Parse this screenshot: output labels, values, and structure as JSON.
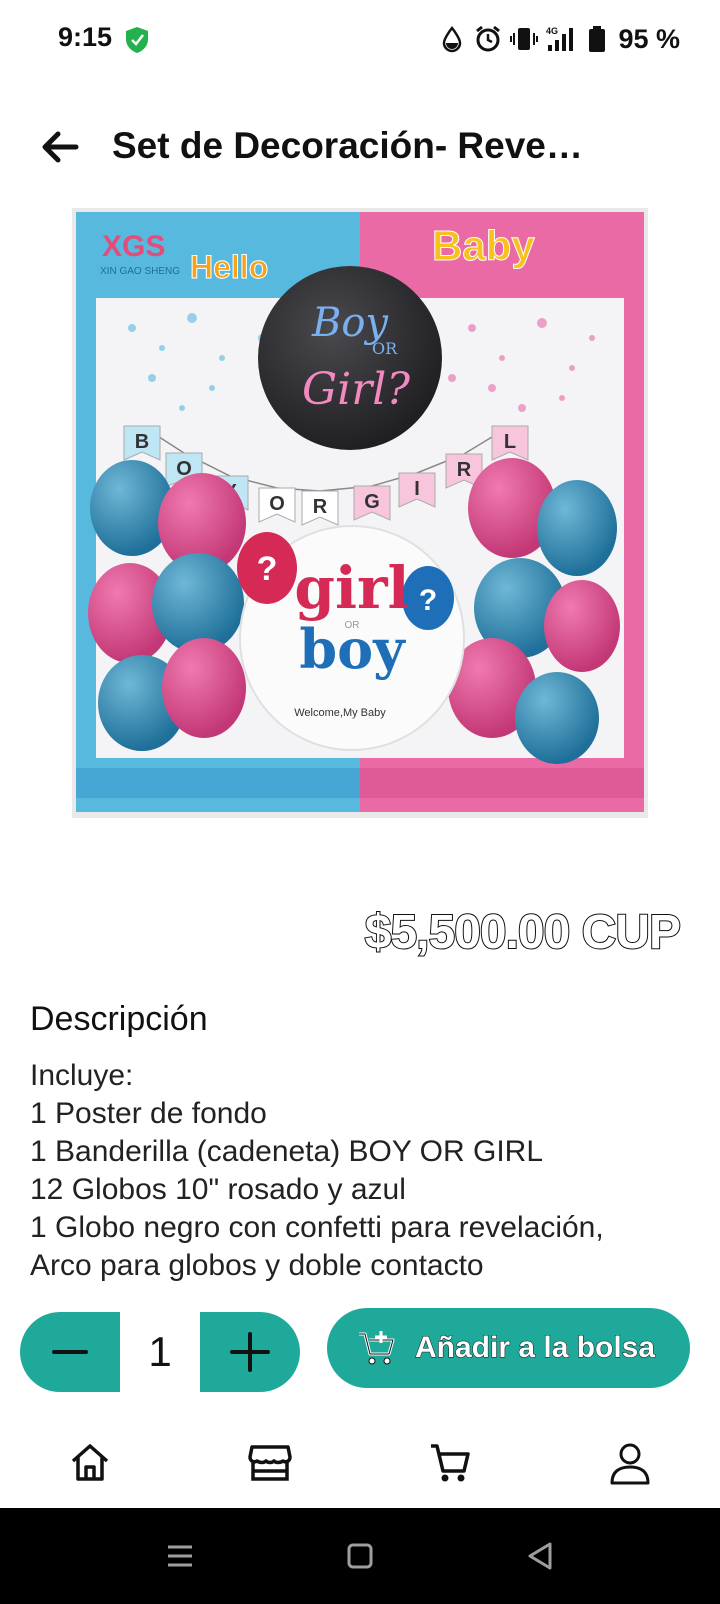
{
  "status_bar": {
    "time": "9:15",
    "battery_text": "95 %",
    "network_label": "4G",
    "icons": [
      "shield-check-icon",
      "water-drop-icon",
      "alarm-icon",
      "vibrate-icon",
      "signal-icon",
      "battery-icon"
    ]
  },
  "header": {
    "title": "Set de Decoración- Reve…",
    "back_icon": "arrow-left-icon"
  },
  "product_image": {
    "brand": "XGS",
    "brand_sub": "XIN GAO SHENG",
    "hello": "Hello",
    "baby": "Baby",
    "balloon_top_1": "Boy",
    "balloon_top_or": "OR",
    "balloon_top_2": "Girl?",
    "banner_letters": [
      "B",
      "O",
      "Y",
      "O",
      "R",
      "G",
      "I",
      "R",
      "L"
    ],
    "sign_line_1": "girl",
    "sign_line_or": "OR",
    "sign_line_2": "boy",
    "sign_welcome": "Welcome,My Baby",
    "colors": {
      "blue": "#4fb3d8",
      "pink": "#e0609a",
      "dark_balloon": "#2a2a2e"
    }
  },
  "product": {
    "price": "$5,500.00 CUP",
    "description_title": "Descripción",
    "description_lines": [
      "Incluye:",
      "1 Poster de fondo",
      "1 Banderilla (cadeneta) BOY OR GIRL",
      "12 Globos 10\" rosado y azul",
      "1 Globo negro con confetti para revelación,",
      "Arco para globos y doble contacto"
    ]
  },
  "cart_controls": {
    "quantity": "1",
    "add_label": "Añadir a la bolsa",
    "accent_color": "#1fa99b"
  },
  "bottom_nav": {
    "items": [
      "home-icon",
      "store-icon",
      "cart-icon",
      "account-icon"
    ]
  },
  "system_nav": {
    "items": [
      "recents-icon",
      "home-square-icon",
      "back-triangle-icon"
    ]
  }
}
